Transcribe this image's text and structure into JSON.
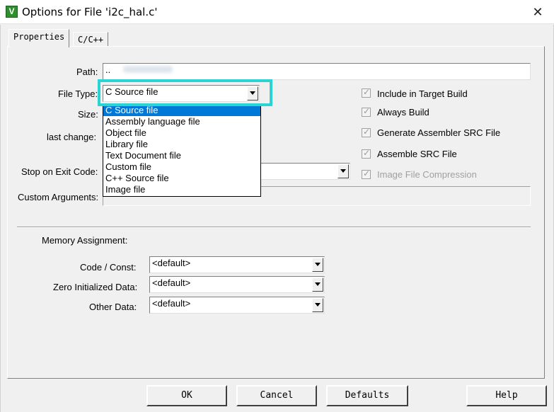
{
  "window": {
    "title": "Options for File 'i2c_hal.c'",
    "icon_text": "V",
    "close_glyph": "✕"
  },
  "tabs": [
    {
      "label": "Properties",
      "active": true
    },
    {
      "label": "C/C++",
      "active": false
    }
  ],
  "form": {
    "path_label": "Path:",
    "path_value": "..",
    "file_type_label": "File Type:",
    "file_type_value": "C Source file",
    "size_label": "Size:",
    "last_change_label": "last change:",
    "stop_on_exit_label": "Stop on Exit Code:",
    "custom_args_label": "Custom Arguments:"
  },
  "file_type_options": [
    "C Source file",
    "Assembly language file",
    "Object file",
    "Library file",
    "Text Document file",
    "Custom file",
    "C++ Source file",
    "Image file"
  ],
  "checkboxes": [
    {
      "label": "Include in Target Build",
      "checked": true,
      "enabled": true
    },
    {
      "label": "Always Build",
      "checked": true,
      "enabled": true
    },
    {
      "label": "Generate Assembler SRC File",
      "checked": true,
      "enabled": true
    },
    {
      "label": "Assemble SRC File",
      "checked": true,
      "enabled": true
    },
    {
      "label": "Image File Compression",
      "checked": true,
      "enabled": false
    }
  ],
  "memory": {
    "section_label": "Memory Assignment:",
    "code_const_label": "Code / Const:",
    "code_const_value": "<default>",
    "zero_init_label": "Zero Initialized Data:",
    "zero_init_value": "<default>",
    "other_data_label": "Other Data:",
    "other_data_value": "<default>"
  },
  "buttons": {
    "ok": "OK",
    "cancel": "Cancel",
    "defaults": "Defaults",
    "help": "Help"
  },
  "colors": {
    "highlight": "#2ad4d4",
    "selection": "#0078d7",
    "app_icon": "#2f8f2f"
  }
}
